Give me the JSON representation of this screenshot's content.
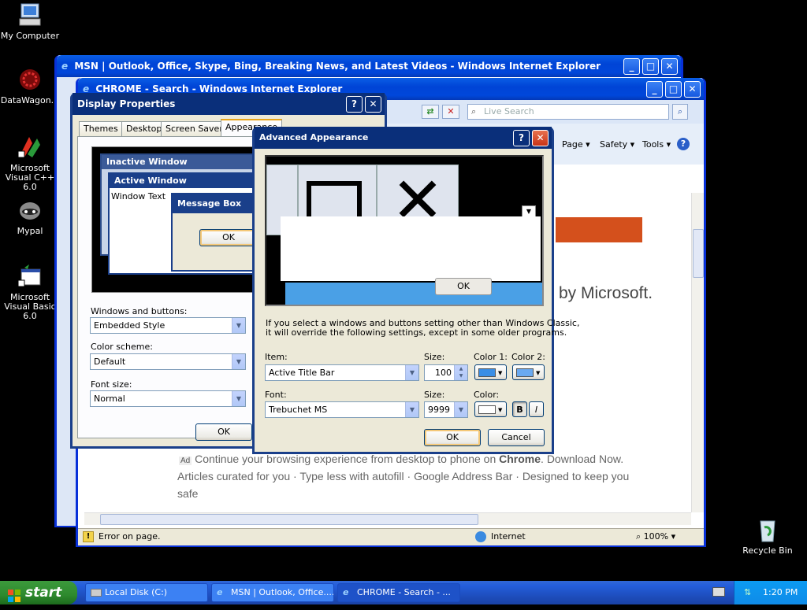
{
  "desktop": {
    "icons": [
      {
        "label": "My Computer"
      },
      {
        "label": "DataWagon..."
      },
      {
        "label": "Microsoft Visual C++ 6.0"
      },
      {
        "label": "Mypal"
      },
      {
        "label": "Microsoft Visual Basic 6.0"
      },
      {
        "label": "Recycle Bin"
      }
    ]
  },
  "ie_back": {
    "title": "MSN | Outlook, Office, Skype, Bing, Breaking News, and Latest Videos - Windows Internet Explorer"
  },
  "ie_front": {
    "title": "CHROME - Search - Windows Internet Explorer",
    "search_placeholder": "Live Search",
    "menu": {
      "page": "Page",
      "safety": "Safety",
      "tools": "Tools"
    },
    "web": {
      "heading_tail": "by Microsoft.",
      "ad_badge": "Ad",
      "ad_text_a": "Continue your browsing experience from desktop to phone on",
      "ad_text_bold": "Chrome",
      "ad_text_b": ". Download Now.",
      "line2": "Articles curated for you · Type less with autofill · Google Address Bar · Designed to keep you",
      "line3": "safe"
    },
    "status": {
      "left": "Error on page.",
      "zone": "Internet",
      "zoom": "100%"
    }
  },
  "display_props": {
    "title": "Display Properties",
    "tabs": [
      "Themes",
      "Desktop",
      "Screen Saver",
      "Appearance"
    ],
    "preview": {
      "inactive": "Inactive Window",
      "active": "Active Window",
      "window_text": "Window Text",
      "msgbox": "Message Box",
      "ok": "OK"
    },
    "windows_buttons_label": "Windows and buttons:",
    "windows_buttons_value": "Embedded Style",
    "color_scheme_label": "Color scheme:",
    "color_scheme_value": "Default",
    "font_size_label": "Font size:",
    "font_size_value": "Normal",
    "ok": "OK"
  },
  "advanced": {
    "title": "Advanced Appearance",
    "preview_ok": "OK",
    "note_line1": "If you select a windows and buttons setting other than Windows Classic,",
    "note_line2": "it will override the following settings, except in some older programs.",
    "item_label": "Item:",
    "item_value": "Active Title Bar",
    "size_label": "Size:",
    "size_value": "100",
    "color1_label": "Color 1:",
    "color2_label": "Color 2:",
    "font_label": "Font:",
    "font_value": "Trebuchet MS",
    "font_size_label": "Size:",
    "font_size_value": "9999",
    "color_label": "Color:",
    "bold": "B",
    "italic": "I",
    "ok": "OK",
    "cancel": "Cancel",
    "colors": {
      "c1": "#3a8ee6",
      "c2": "#6aa9f0",
      "font": "#ffffff"
    }
  },
  "taskbar": {
    "start": "start",
    "tasks": [
      "Local Disk (C:)",
      "MSN | Outlook, Office....",
      "CHROME - Search - ..."
    ],
    "clock": "1:20 PM"
  }
}
